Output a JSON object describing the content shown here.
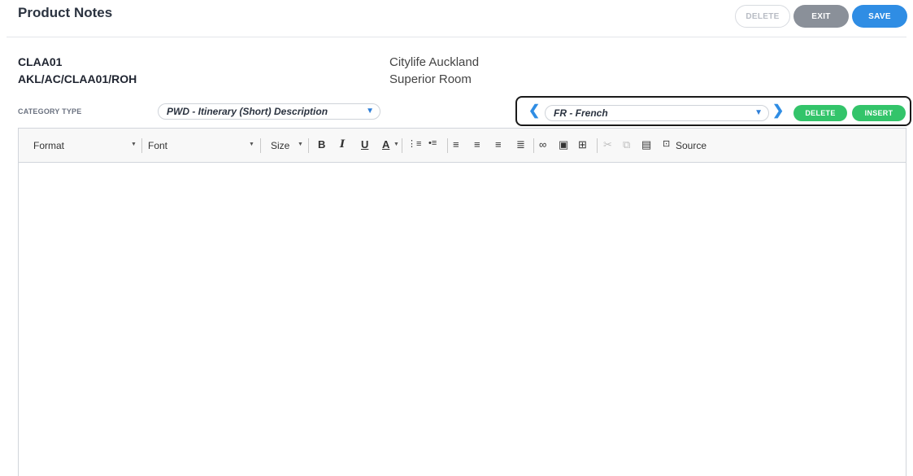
{
  "header": {
    "title": "Product Notes",
    "delete_label": "DELETE",
    "exit_label": "EXIT",
    "save_label": "SAVE"
  },
  "product": {
    "code": "CLAA01",
    "path": "AKL/AC/CLAA01/ROH",
    "property": "Citylife Auckland",
    "room": "Superior Room"
  },
  "category": {
    "label": "CATEGORY TYPE",
    "selected": "PWD - Itinerary (Short) Description"
  },
  "language": {
    "selected": "FR - French",
    "delete_label": "DELETE",
    "insert_label": "INSERT"
  },
  "editor": {
    "format_label": "Format",
    "font_label": "Font",
    "size_label": "Size",
    "source_label": "Source",
    "content": ""
  },
  "colors": {
    "accent": "#2f8de4",
    "green": "#33c46a",
    "exit_gray": "#8a9099"
  }
}
